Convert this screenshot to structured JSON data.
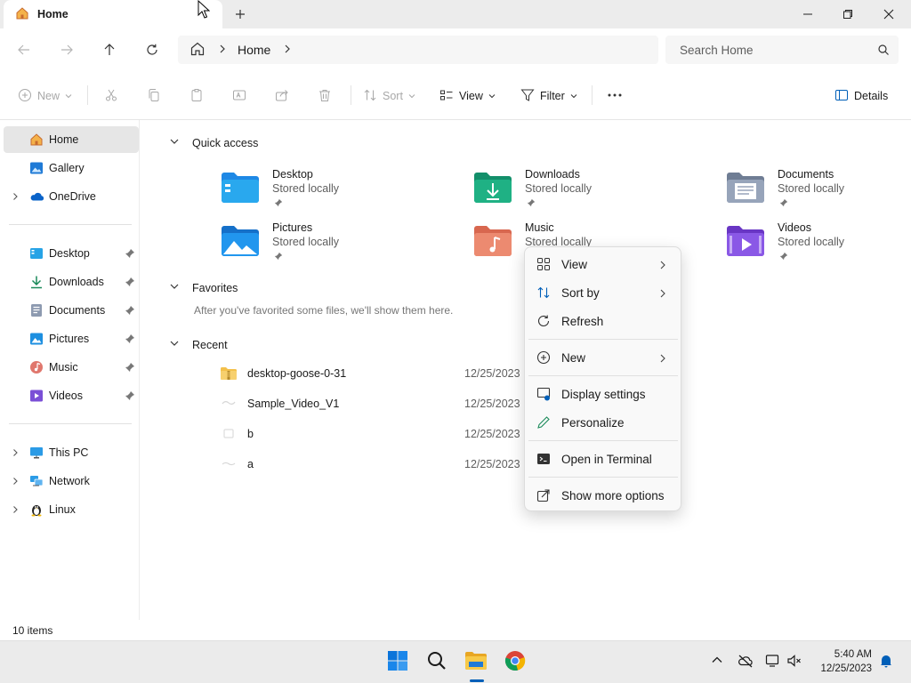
{
  "window": {
    "tab_title": "Home"
  },
  "address": {
    "breadcrumb": "Home",
    "search_placeholder": "Search Home"
  },
  "toolbar": {
    "new_label": "New",
    "sort_label": "Sort",
    "view_label": "View",
    "filter_label": "Filter",
    "details_label": "Details"
  },
  "sidebar": {
    "items": [
      {
        "label": "Home",
        "icon": "home-icon"
      },
      {
        "label": "Gallery",
        "icon": "gallery-icon"
      },
      {
        "label": "OneDrive",
        "icon": "onedrive-icon"
      },
      {
        "label": "Desktop",
        "icon": "desktop-icon"
      },
      {
        "label": "Downloads",
        "icon": "downloads-icon"
      },
      {
        "label": "Documents",
        "icon": "documents-icon"
      },
      {
        "label": "Pictures",
        "icon": "pictures-icon"
      },
      {
        "label": "Music",
        "icon": "music-icon"
      },
      {
        "label": "Videos",
        "icon": "videos-icon"
      },
      {
        "label": "This PC",
        "icon": "this-pc-icon"
      },
      {
        "label": "Network",
        "icon": "network-icon"
      },
      {
        "label": "Linux",
        "icon": "linux-icon"
      }
    ]
  },
  "quick_access": {
    "title": "Quick access",
    "folders": [
      {
        "name": "Desktop",
        "status": "Stored locally"
      },
      {
        "name": "Downloads",
        "status": "Stored locally"
      },
      {
        "name": "Documents",
        "status": "Stored locally"
      },
      {
        "name": "Pictures",
        "status": "Stored locally"
      },
      {
        "name": "Music",
        "status": "Stored locally"
      },
      {
        "name": "Videos",
        "status": "Stored locally"
      }
    ]
  },
  "favorites": {
    "title": "Favorites",
    "empty_message": "After you've favorited some files, we'll show them here."
  },
  "recent": {
    "title": "Recent",
    "files": [
      {
        "name": "desktop-goose-0-31",
        "date": "12/25/2023"
      },
      {
        "name": "Sample_Video_V1",
        "date": "12/25/2023"
      },
      {
        "name": "b",
        "date": "12/25/2023"
      },
      {
        "name": "a",
        "date": "12/25/2023"
      }
    ]
  },
  "context_menu": {
    "items": [
      {
        "label": "View",
        "icon": "grid-icon"
      },
      {
        "label": "Sort by",
        "icon": "sort-icon"
      },
      {
        "label": "Refresh",
        "icon": "refresh-icon"
      },
      {
        "label": "New",
        "icon": "plus-circle-icon"
      },
      {
        "label": "Display settings",
        "icon": "display-icon"
      },
      {
        "label": "Personalize",
        "icon": "pen-icon"
      },
      {
        "label": "Open in Terminal",
        "icon": "terminal-icon"
      },
      {
        "label": "Show more options",
        "icon": "share-icon"
      }
    ]
  },
  "status": {
    "item_count": "10 items"
  },
  "taskbar": {
    "time": "5:40 AM",
    "date": "12/25/2023"
  },
  "colors": {
    "accent": "#005fb8",
    "folder_yellow": "#f3c04b",
    "selection": "#e6e6e6"
  }
}
